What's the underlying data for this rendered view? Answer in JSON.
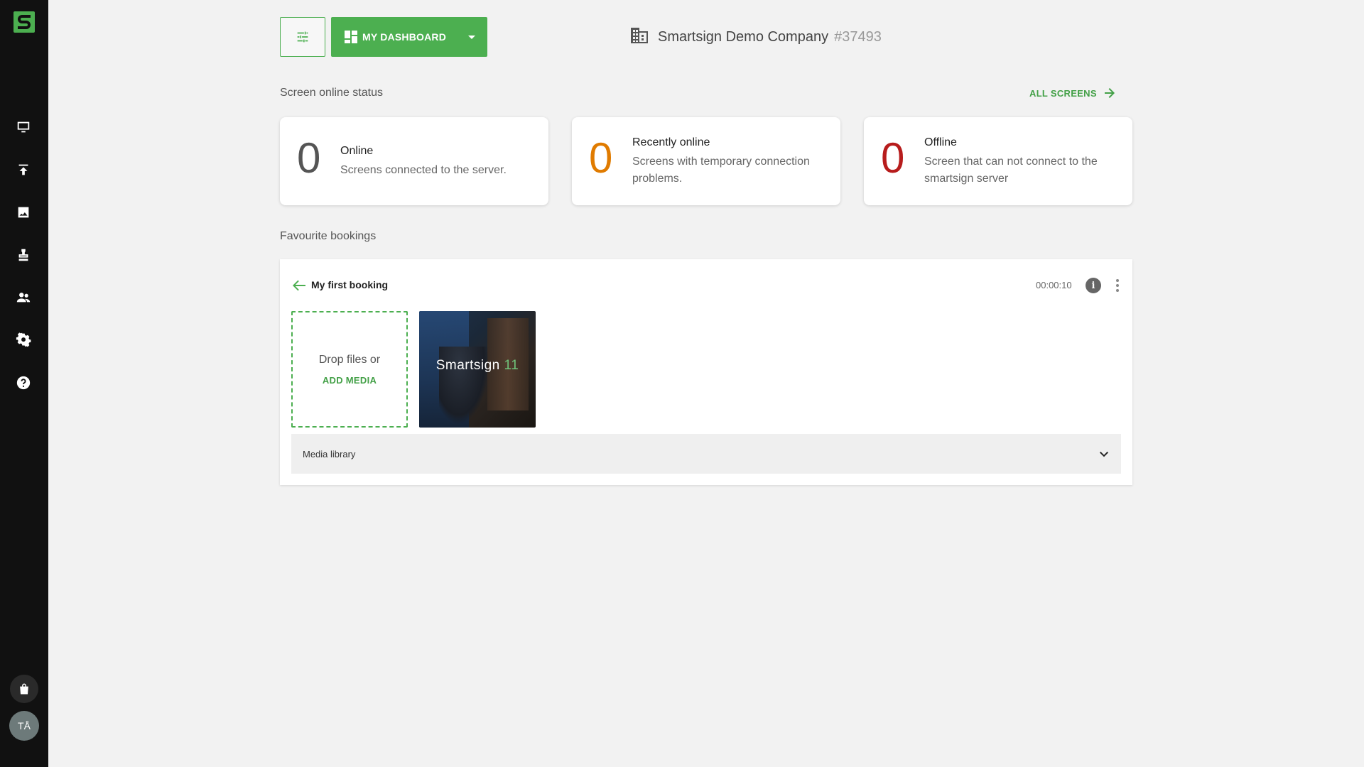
{
  "sidebar": {
    "logo_letter": "S",
    "items": [
      {
        "name": "screens",
        "icon": "monitor-icon"
      },
      {
        "name": "publish",
        "icon": "upload-icon"
      },
      {
        "name": "media",
        "icon": "image-icon"
      },
      {
        "name": "bookings",
        "icon": "stamp-icon"
      },
      {
        "name": "users",
        "icon": "people-icon"
      },
      {
        "name": "settings",
        "icon": "gear-icon"
      },
      {
        "name": "help",
        "icon": "help-icon"
      }
    ],
    "store_icon": "shopping-bag-icon",
    "avatar_initials": "TÅ"
  },
  "topbar": {
    "dashboard_label": "MY DASHBOARD",
    "company_name": "Smartsign Demo Company",
    "company_id": "#37493"
  },
  "status": {
    "title": "Screen online status",
    "all_screens_label": "ALL SCREENS",
    "cards": [
      {
        "count": "0",
        "title": "Online",
        "description": "Screens connected to the server.",
        "color": "#555555"
      },
      {
        "count": "0",
        "title": "Recently online",
        "description": "Screens with temporary connection problems.",
        "color": "#e07b00"
      },
      {
        "count": "0",
        "title": "Offline",
        "description": "Screen that can not connect to the smartsign server",
        "color": "#b71c1c"
      }
    ]
  },
  "favourites": {
    "title": "Favourite bookings",
    "booking": {
      "title": "My first booking",
      "duration": "00:00:10",
      "info_glyph": "i",
      "dropzone_text": "Drop files or",
      "add_media_label": "ADD MEDIA",
      "thumbnail_brand": "Smartsign",
      "thumbnail_version": "11",
      "media_library_label": "Media library"
    }
  },
  "colors": {
    "accent": "#4caf50",
    "sidebar": "#111111",
    "background": "#f2f2f2"
  }
}
